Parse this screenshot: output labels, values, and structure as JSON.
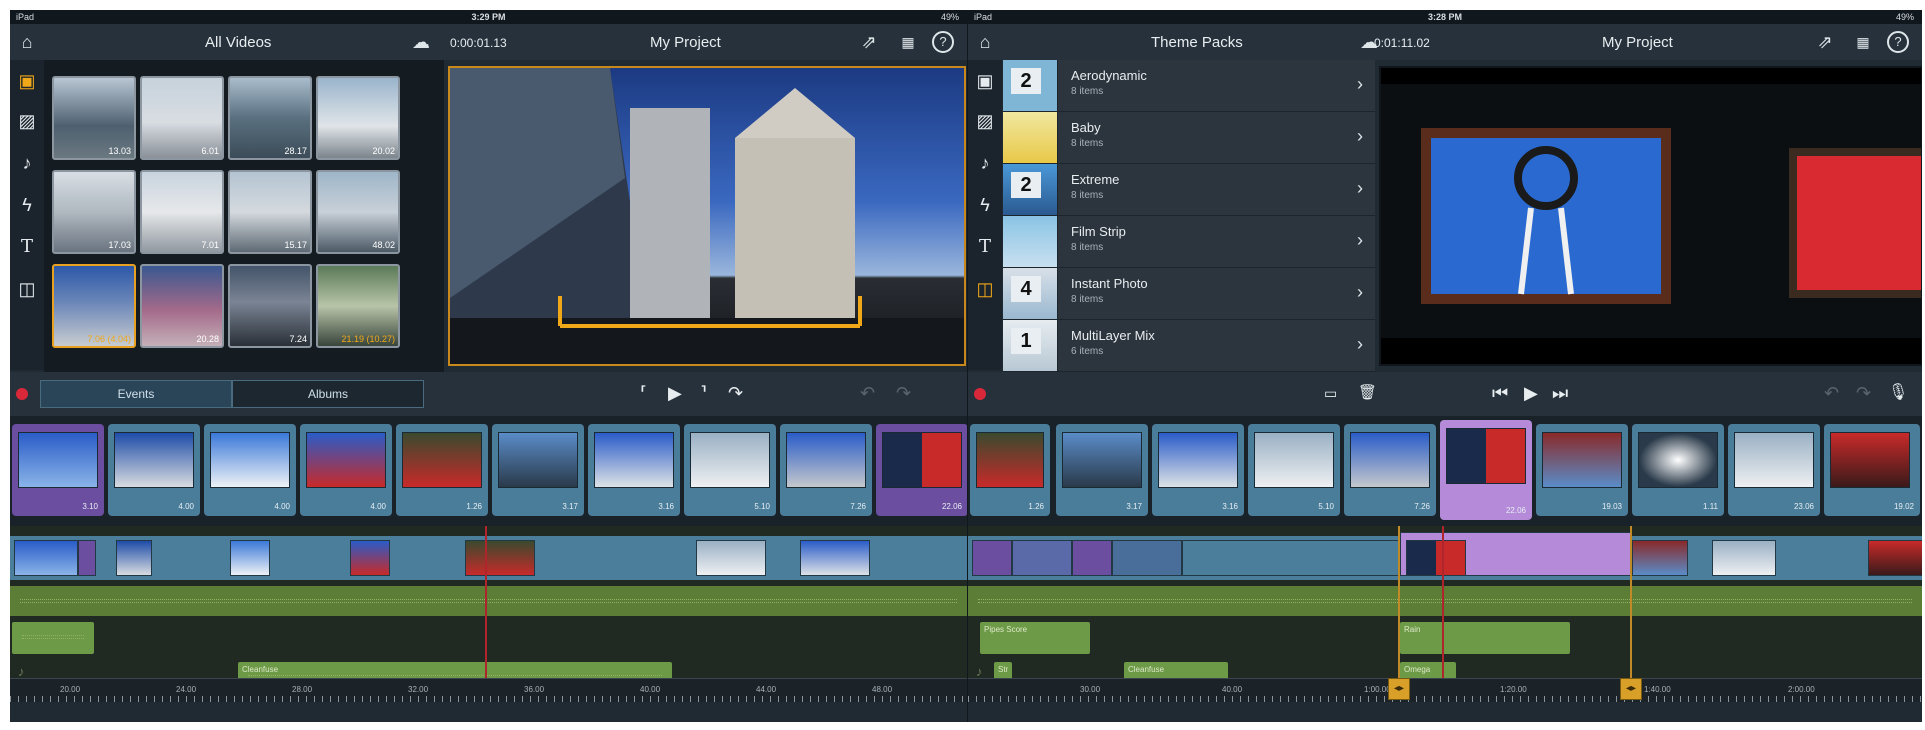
{
  "left": {
    "status": {
      "device": "iPad",
      "time": "3:29 PM",
      "battery": "49%"
    },
    "topbar": {
      "browser_title": "All Videos",
      "timecode": "0:00:01.13",
      "project_title": "My Project"
    },
    "sidebar_icons": [
      "film-icon",
      "photo-icon",
      "music-icon",
      "lightning-icon",
      "text-icon",
      "layers-icon"
    ],
    "thumbs": [
      {
        "dur": "13.03"
      },
      {
        "dur": "6.01"
      },
      {
        "dur": "28.17"
      },
      {
        "dur": "20.02"
      },
      {
        "dur": "17.03"
      },
      {
        "dur": "7.01"
      },
      {
        "dur": "15.17"
      },
      {
        "dur": "48.02"
      },
      {
        "dur": "7.06 (4.04)"
      },
      {
        "dur": "20.28"
      },
      {
        "dur": "7.24"
      },
      {
        "dur": "21.19 (10.27)"
      }
    ],
    "tabs": {
      "events": "Events",
      "albums": "Albums"
    },
    "storyboard_durations": [
      "3.10",
      "4.00",
      "4.00",
      "4.00",
      "1.26",
      "3.17",
      "3.16",
      "5.10",
      "7.26",
      "22.06"
    ],
    "audio_labels": {
      "clip1": "Cleanfuse"
    },
    "ruler": [
      "20.00",
      "24.00",
      "28.00",
      "32.00",
      "36.00",
      "40.00",
      "44.00",
      "48.00"
    ]
  },
  "right": {
    "status": {
      "device": "iPad",
      "time": "3:28 PM",
      "battery": "49%"
    },
    "topbar": {
      "browser_title": "Theme Packs",
      "timecode": "0:01:11.02",
      "project_title": "My Project"
    },
    "themes": [
      {
        "name": "Aerodynamic",
        "count": "8 items",
        "num": "2"
      },
      {
        "name": "Baby",
        "count": "8 items",
        "num": ""
      },
      {
        "name": "Extreme",
        "count": "8 items",
        "num": "2"
      },
      {
        "name": "Film Strip",
        "count": "8 items",
        "num": ""
      },
      {
        "name": "Instant Photo",
        "count": "8 items",
        "num": "4"
      },
      {
        "name": "MultiLayer Mix",
        "count": "6 items",
        "num": "1"
      }
    ],
    "storyboard_durations": [
      "1.26",
      "3.17",
      "3.16",
      "5.10",
      "7.26",
      "22.06",
      "19.03",
      "1.11",
      "23.06",
      "19.02"
    ],
    "audio_labels": {
      "a": "Pipes Score",
      "b": "Rain",
      "c": "Cleanfuse",
      "d": "Omega",
      "e": "Str"
    },
    "ruler": [
      "30.00",
      "40.00",
      "1:00.00",
      "1:20.00",
      "1:40.00",
      "2:00.00"
    ]
  },
  "colors": {
    "accent": "#e8a020",
    "record": "#d8283a",
    "video_track": "#4b7e9a",
    "audio_track": "#6d9a46",
    "selected_clip": "#b58ad8"
  }
}
